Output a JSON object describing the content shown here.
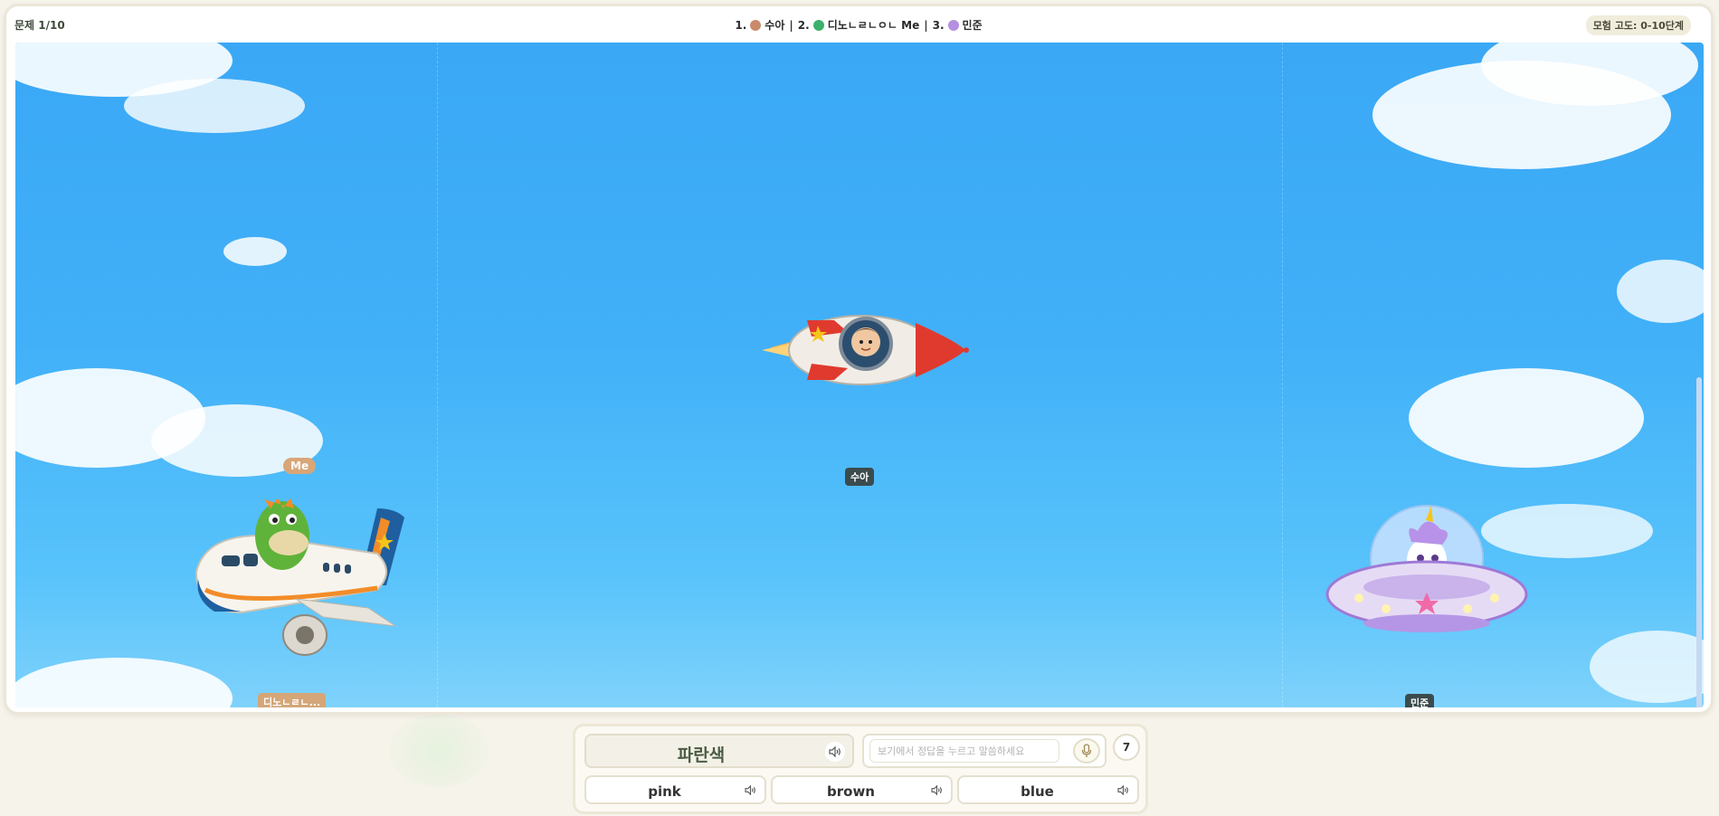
{
  "header": {
    "question_counter": "문제 1/10",
    "rankings": [
      {
        "rank": "1.",
        "name": "수아"
      },
      {
        "rank": "2.",
        "name": "디노ㄴㄹㄴㅇㄴ Me"
      },
      {
        "rank": "3.",
        "name": "민준"
      }
    ],
    "separator": "|",
    "altitude_label": "모험 고도: 0-10단계"
  },
  "players": {
    "left": {
      "me_label": "Me",
      "name": "디노ㄴㄹㄴ...",
      "vehicle": "airplane-icon",
      "character": "dinosaur"
    },
    "center": {
      "name": "수아",
      "vehicle": "rocket-icon",
      "character": "boy-astronaut"
    },
    "right": {
      "name": "민준",
      "vehicle": "ufo-icon",
      "character": "unicorn"
    }
  },
  "question": {
    "prompt": "파란색",
    "input_placeholder": "보기에서 정답을 누르고 말씀하세요",
    "timer": "7"
  },
  "options": [
    {
      "label": "pink"
    },
    {
      "label": "brown"
    },
    {
      "label": "blue"
    }
  ],
  "colors": {
    "sky_top": "#3aa8f5",
    "sky_bottom": "#7fd2fb",
    "name_tag": "#3b4b4d",
    "my_tag": "#d4a679",
    "prompt_text": "#4b5c42"
  }
}
